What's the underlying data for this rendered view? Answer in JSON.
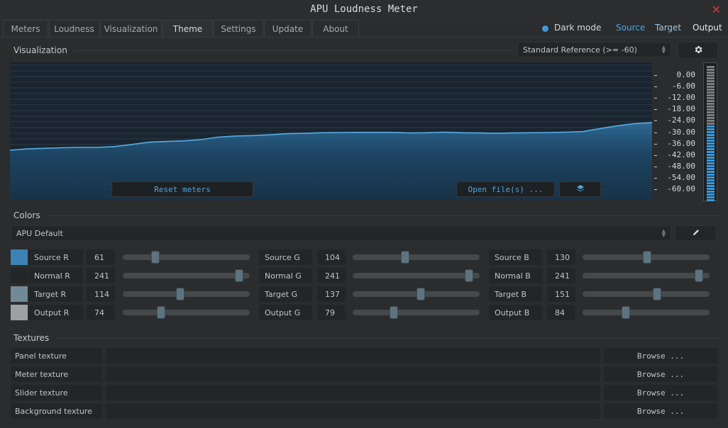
{
  "window": {
    "title": "APU Loudness Meter",
    "close_label": "✕"
  },
  "tabs": [
    "Meters",
    "Loudness",
    "Visualization",
    "Theme",
    "Settings",
    "Update",
    "About"
  ],
  "active_tab": "Theme",
  "topbar": {
    "dark_mode_label": "Dark mode",
    "source_label": "Source",
    "target_label": "Target",
    "output_label": "Output"
  },
  "visualization": {
    "section_label": "Visualization",
    "reference_select": "Standard Reference (>= -60)",
    "settings_icon": "gear-icon",
    "scale_labels": [
      "0.00",
      "-6.00",
      "-12.00",
      "-18.00",
      "-24.00",
      "-30.00",
      "-36.00",
      "-42.00",
      "-48.00",
      "-54.00",
      "-60.00"
    ],
    "reset_label": "Reset meters",
    "open_label": "Open file(s) ...",
    "layers_icon": "layers-icon",
    "history_db": [
      -39.5,
      -38.8,
      -38.5,
      -38.2,
      -38.0,
      -38.0,
      -37.6,
      -36.5,
      -35.3,
      -34.9,
      -34.6,
      -33.9,
      -32.6,
      -32.0,
      -31.8,
      -31.4,
      -30.8,
      -30.6,
      -30.3,
      -30.2,
      -30.1,
      -30.1,
      -30.1,
      -30.4,
      -30.3,
      -30.0,
      -30.3,
      -30.4,
      -30.6,
      -30.4,
      -30.3,
      -30.2,
      -30.0,
      -29.7,
      -28.1,
      -26.7,
      -25.5,
      -25.0
    ],
    "meter_level_db": -26
  },
  "colors": {
    "section_label": "Colors",
    "preset": "APU Default",
    "edit_icon": "pencil-icon",
    "rows": [
      {
        "swatch": "#3d82b4",
        "cells": [
          {
            "label": "Source R",
            "value": 61
          },
          {
            "label": "Source G",
            "value": 104
          },
          {
            "label": "Source B",
            "value": 130
          }
        ]
      },
      {
        "swatch": "#232527",
        "cells": [
          {
            "label": "Normal R",
            "value": 241
          },
          {
            "label": "Normal G",
            "value": 241
          },
          {
            "label": "Normal B",
            "value": 241
          }
        ]
      },
      {
        "swatch": "#728997",
        "cells": [
          {
            "label": "Target R",
            "value": 114
          },
          {
            "label": "Target G",
            "value": 137
          },
          {
            "label": "Target B",
            "value": 151
          }
        ]
      },
      {
        "swatch": "#9ca1a6",
        "cells": [
          {
            "label": "Output R",
            "value": 74
          },
          {
            "label": "Output G",
            "value": 79
          },
          {
            "label": "Output B",
            "value": 84
          }
        ]
      }
    ]
  },
  "textures": {
    "section_label": "Textures",
    "rows": [
      {
        "label": "Panel texture",
        "button": "Browse ..."
      },
      {
        "label": "Meter texture",
        "button": "Browse ..."
      },
      {
        "label": "Slider texture",
        "button": "Browse ..."
      },
      {
        "label": "Background texture",
        "button": "Browse ..."
      }
    ]
  },
  "theme": {
    "accent": "#4ba6e6",
    "close_color": "#d9383a"
  }
}
